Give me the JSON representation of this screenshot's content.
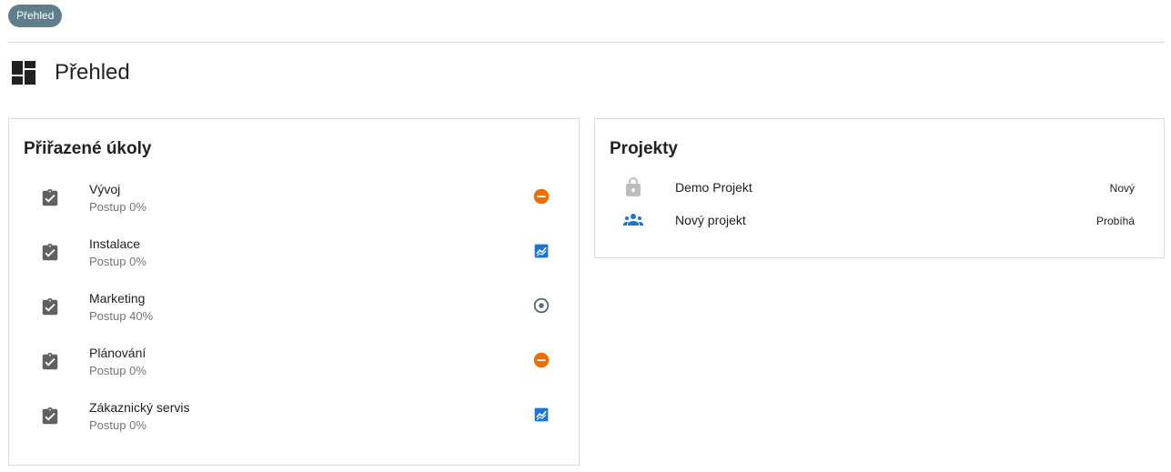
{
  "breadcrumb": {
    "label": "Přehled"
  },
  "header": {
    "title": "Přehled",
    "icon": "dashboard-icon"
  },
  "colors": {
    "chip": "#607d8b",
    "icon_gray": "#616161",
    "orange": "#ef6c00",
    "blue": "#1976d2",
    "slate": "#546e7a",
    "lock_gray": "#bdbdbd"
  },
  "tasks": {
    "title": "Přiřazené úkoly",
    "items": [
      {
        "name": "Vývoj",
        "progress": "Postup 0%",
        "status_icon": "minus-circle-icon"
      },
      {
        "name": "Instalace",
        "progress": "Postup 0%",
        "status_icon": "chart-icon"
      },
      {
        "name": "Marketing",
        "progress": "Postup 40%",
        "status_icon": "target-circle-icon"
      },
      {
        "name": "Plánování",
        "progress": "Postup 0%",
        "status_icon": "minus-circle-icon"
      },
      {
        "name": "Zákaznický servis",
        "progress": "Postup 0%",
        "status_icon": "chart-icon"
      }
    ]
  },
  "projects": {
    "title": "Projekty",
    "items": [
      {
        "name": "Demo Projekt",
        "status": "Nový",
        "icon": "lock-icon"
      },
      {
        "name": "Nový projekt",
        "status": "Probíhá",
        "icon": "group-icon"
      }
    ]
  }
}
